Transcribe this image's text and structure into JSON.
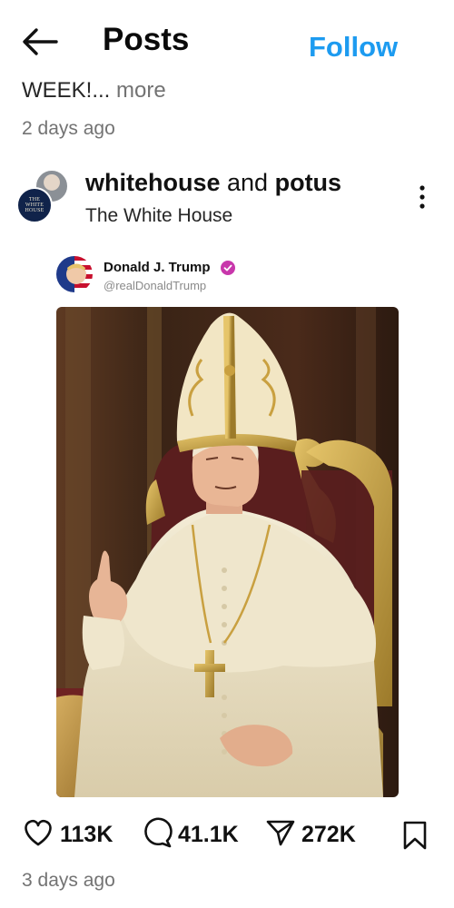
{
  "header": {
    "title": "Posts",
    "follow_label": "Follow"
  },
  "previous_post": {
    "caption": "WEEK!...",
    "more_label": " more",
    "time": "2 days ago"
  },
  "post": {
    "account_primary": "whitehouse",
    "account_joiner": " and ",
    "account_secondary": "potus",
    "page_name": "The White House",
    "avatar_front_text": [
      "THE",
      "WHITE",
      "HOUSE"
    ],
    "embedded": {
      "name": "Donald J. Trump",
      "handle": "@realDonaldTrump"
    },
    "actions": {
      "likes": "113K",
      "replies": "41.1K",
      "shares": "272K"
    },
    "time": "3 days ago"
  },
  "colors": {
    "accent": "#1d9bf0",
    "verified": "#c837ab"
  },
  "icons": [
    "back-arrow-icon",
    "more-vertical-icon",
    "verified-badge-icon",
    "heart-icon",
    "comment-icon",
    "send-icon",
    "bookmark-icon"
  ]
}
